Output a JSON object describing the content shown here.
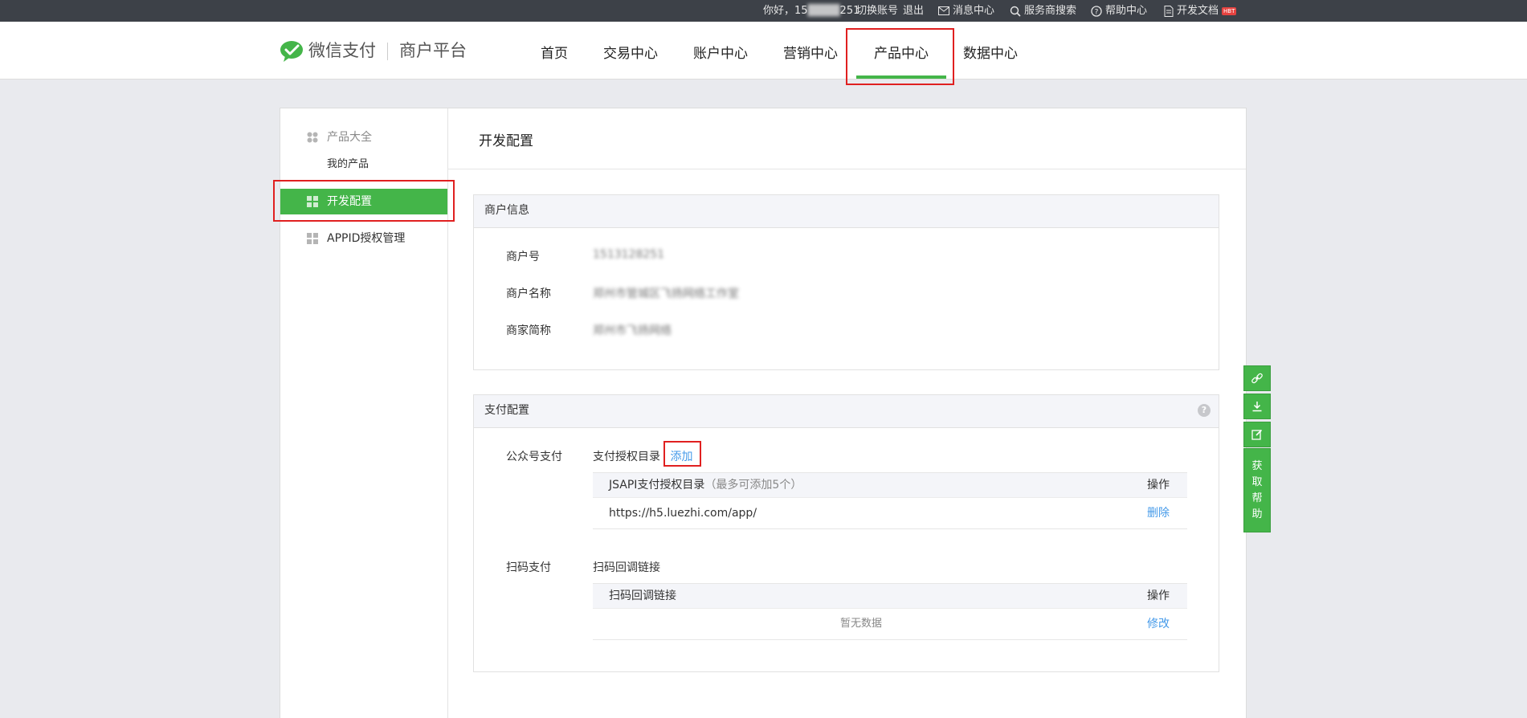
{
  "topbar": {
    "greeting": "你好，15",
    "account_tail": "251",
    "switch_account": "切换账号",
    "logout": "退出",
    "messages": "消息中心",
    "provider_search": "服务商搜索",
    "help_center": "帮助中心",
    "dev_docs": "开发文档",
    "dev_docs_badge": "HBT"
  },
  "header": {
    "logo_brand": "微信支付",
    "logo_product": "商户平台",
    "nav": [
      "首页",
      "交易中心",
      "账户中心",
      "营销中心",
      "产品中心",
      "数据中心"
    ],
    "active_nav": "产品中心"
  },
  "sidebar": {
    "group_title": "产品大全",
    "my_products": "我的产品",
    "dev_config": "开发配置",
    "appid_auth": "APPID授权管理"
  },
  "content": {
    "page_title": "开发配置",
    "merchant_info": {
      "title": "商户信息",
      "rows": [
        {
          "label": "商户号",
          "value": "1513128251"
        },
        {
          "label": "商户名称",
          "value": "郑州市管城区飞扬网络工作室"
        },
        {
          "label": "商家简称",
          "value": "郑州市飞扬网络"
        }
      ]
    },
    "pay_config": {
      "title": "支付配置",
      "help_mark": "?",
      "jsapi": {
        "label": "公众号支付",
        "dir_title": "支付授权目录",
        "add_link": "添加",
        "table_header": "JSAPI支付授权目录",
        "table_hint": "（最多可添加5个）",
        "op_header": "操作",
        "rows": [
          {
            "url": "https://h5.luezhi.com/app/",
            "action": "删除"
          }
        ]
      },
      "native": {
        "label": "扫码支付",
        "sub_title": "扫码回调链接",
        "table_header": "扫码回调链接",
        "op_header": "操作",
        "empty_text": "暂无数据",
        "action": "修改"
      }
    }
  },
  "float_toolbar": {
    "help_text": [
      "获",
      "取",
      "帮",
      "助"
    ],
    "icons": [
      "link-icon",
      "download-icon",
      "edit-icon"
    ]
  },
  "colors": {
    "accent_green": "#44b549",
    "link_blue": "#459ae9",
    "highlight_red": "#e02020",
    "topbar_bg": "#3d4148"
  }
}
